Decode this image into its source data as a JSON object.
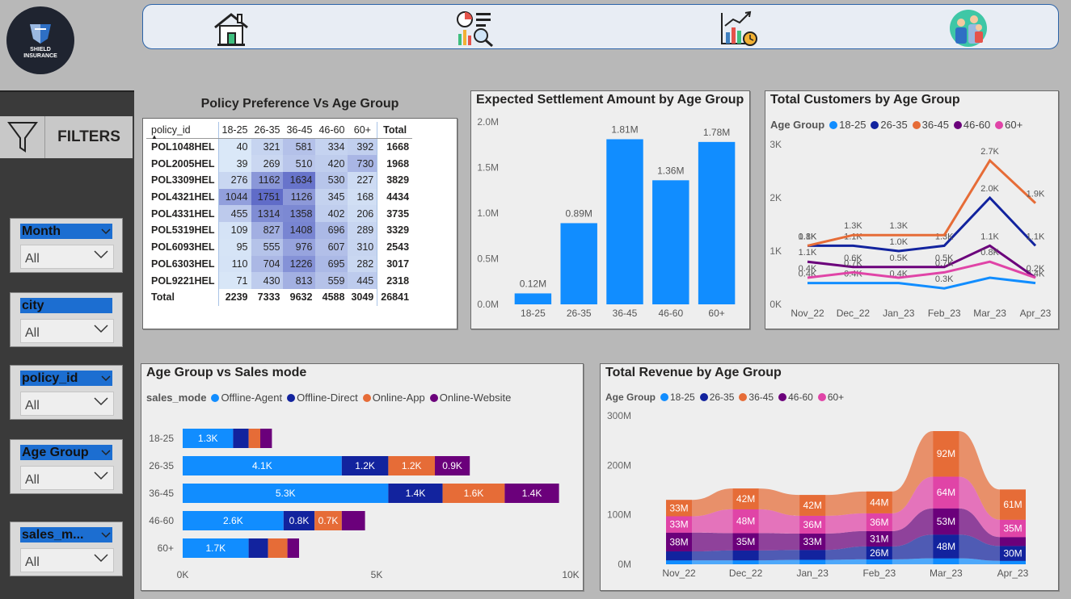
{
  "logo": {
    "line1": "SHIELD",
    "line2": "INSURANCE"
  },
  "nav": {
    "icons": [
      "home-icon",
      "analysis-report-icon",
      "growth-chart-icon",
      "customers-group-icon"
    ]
  },
  "filters": {
    "header": "FILTERS",
    "slicers": [
      {
        "title": "Month",
        "value": "All"
      },
      {
        "title": "city",
        "value": "All"
      },
      {
        "title": "policy_id",
        "value": "All"
      },
      {
        "title": "Age Group",
        "value": "All"
      },
      {
        "title": "sales_m...",
        "value": "All"
      }
    ]
  },
  "matrix": {
    "title": "Policy Preference Vs Age Group",
    "columns": [
      "policy_id",
      "18-25",
      "26-35",
      "36-45",
      "46-60",
      "60+",
      "Total"
    ],
    "rows": [
      {
        "id": "POL1048HEL",
        "vals": [
          40,
          321,
          581,
          334,
          392
        ],
        "total": 1668
      },
      {
        "id": "POL2005HEL",
        "vals": [
          39,
          269,
          510,
          420,
          730
        ],
        "total": 1968
      },
      {
        "id": "POL3309HEL",
        "vals": [
          276,
          1162,
          1634,
          530,
          227
        ],
        "total": 3829
      },
      {
        "id": "POL4321HEL",
        "vals": [
          1044,
          1751,
          1126,
          345,
          168
        ],
        "total": 4434
      },
      {
        "id": "POL4331HEL",
        "vals": [
          455,
          1314,
          1358,
          402,
          206
        ],
        "total": 3735
      },
      {
        "id": "POL5319HEL",
        "vals": [
          109,
          827,
          1408,
          696,
          289
        ],
        "total": 3329
      },
      {
        "id": "POL6093HEL",
        "vals": [
          95,
          555,
          976,
          607,
          310
        ],
        "total": 2543
      },
      {
        "id": "POL6303HEL",
        "vals": [
          110,
          704,
          1226,
          695,
          282
        ],
        "total": 3017
      },
      {
        "id": "POL9221HEL",
        "vals": [
          71,
          430,
          813,
          559,
          445
        ],
        "total": 2318
      }
    ],
    "total_row": {
      "label": "Total",
      "vals": [
        2239,
        7333,
        9632,
        4588,
        3049
      ],
      "total": 26841
    }
  },
  "chart_data": [
    {
      "id": "settlement",
      "type": "bar",
      "title": "Expected Settlement Amount by Age Group",
      "categories": [
        "18-25",
        "26-35",
        "36-45",
        "46-60",
        "60+"
      ],
      "values": [
        0.12,
        0.89,
        1.81,
        1.36,
        1.78
      ],
      "labels": [
        "0.12M",
        "0.89M",
        "1.81M",
        "1.36M",
        "1.78M"
      ],
      "yticks": [
        "0.0M",
        "0.5M",
        "1.0M",
        "1.5M",
        "2.0M"
      ],
      "ylim": [
        0,
        2.0
      ],
      "color": "#118dff"
    },
    {
      "id": "customers",
      "type": "line",
      "title": "Total Customers by Age Group",
      "legend_title": "Age Group",
      "x": [
        "Nov_22",
        "Dec_22",
        "Jan_23",
        "Feb_23",
        "Mar_23",
        "Apr_23"
      ],
      "yticks": [
        "0K",
        "1K",
        "2K",
        "3K"
      ],
      "ylim": [
        0,
        3
      ],
      "series": [
        {
          "name": "18-25",
          "color": "#118dff",
          "values": [
            0.4,
            0.4,
            0.4,
            0.3,
            0.5,
            0.4
          ],
          "labels": [
            "0.4K",
            "0.4K",
            "0.4K",
            "0.3K",
            "",
            "0.4K"
          ]
        },
        {
          "name": "26-35",
          "color": "#12239e",
          "values": [
            1.1,
            1.1,
            1.0,
            1.1,
            2.0,
            1.1
          ],
          "labels": [
            "1.1K",
            "1.1K",
            "1.0K",
            "1.3K",
            "2.0K",
            "1.1K"
          ]
        },
        {
          "name": "36-45",
          "color": "#e66c37",
          "values": [
            1.1,
            1.3,
            1.3,
            1.3,
            2.7,
            1.9
          ],
          "labels": [
            "0.8K",
            "1.3K",
            "1.3K",
            "",
            "2.7K",
            "1.9K"
          ]
        },
        {
          "name": "46-60",
          "color": "#6b007b",
          "values": [
            0.8,
            0.7,
            0.7,
            0.7,
            1.1,
            0.5
          ],
          "labels": [
            "1.1K",
            "0.6K",
            "0.5K",
            "0.5K",
            "1.1K",
            "0.2K"
          ]
        },
        {
          "name": "60+",
          "color": "#e044a7",
          "values": [
            0.5,
            0.6,
            0.5,
            0.6,
            0.8,
            0.5
          ],
          "labels": [
            "0.4K",
            "0.7K",
            "",
            "0.7K",
            "0.8K",
            ""
          ]
        }
      ]
    },
    {
      "id": "salesmode",
      "type": "bar",
      "title": "Age Group vs Sales mode",
      "legend_title": "sales_mode",
      "categories": [
        "18-25",
        "26-35",
        "36-45",
        "46-60",
        "60+"
      ],
      "xticks": [
        "0K",
        "5K",
        "10K"
      ],
      "xlim": [
        0,
        10
      ],
      "series": [
        {
          "name": "Offline-Agent",
          "color": "#118dff",
          "values": [
            1.3,
            4.1,
            5.3,
            2.6,
            1.7
          ],
          "labels": [
            "1.3K",
            "4.1K",
            "5.3K",
            "2.6K",
            "1.7K"
          ]
        },
        {
          "name": "Offline-Direct",
          "color": "#12239e",
          "values": [
            0.4,
            1.2,
            1.4,
            0.8,
            0.5
          ],
          "labels": [
            "",
            "1.2K",
            "1.4K",
            "0.8K",
            ""
          ]
        },
        {
          "name": "Online-App",
          "color": "#e66c37",
          "values": [
            0.3,
            1.2,
            1.6,
            0.7,
            0.5
          ],
          "labels": [
            "",
            "1.2K",
            "1.6K",
            "0.7K",
            ""
          ]
        },
        {
          "name": "Online-Website",
          "color": "#6b007b",
          "values": [
            0.3,
            0.9,
            1.4,
            0.6,
            0.3
          ],
          "labels": [
            "",
            "0.9K",
            "1.4K",
            "",
            ""
          ]
        }
      ]
    },
    {
      "id": "revenue",
      "type": "area",
      "title": "Total Revenue by Age Group",
      "legend_title": "Age Group",
      "x": [
        "Nov_22",
        "Dec_22",
        "Jan_23",
        "Feb_23",
        "Mar_23",
        "Apr_23"
      ],
      "yticks": [
        "0M",
        "100M",
        "200M",
        "300M"
      ],
      "ylim": [
        0,
        300
      ],
      "series": [
        {
          "name": "18-25",
          "color": "#118dff",
          "values": [
            8,
            8,
            9,
            10,
            12,
            7
          ],
          "labels": [
            "",
            "",
            "",
            "",
            "",
            ""
          ]
        },
        {
          "name": "26-35",
          "color": "#12239e",
          "values": [
            18,
            20,
            20,
            26,
            48,
            30
          ],
          "labels": [
            "",
            "",
            "",
            "26M",
            "48M",
            "30M"
          ]
        },
        {
          "name": "46-60",
          "color": "#6b007b",
          "values": [
            38,
            35,
            33,
            31,
            53,
            18
          ],
          "labels": [
            "38M",
            "35M",
            "33M",
            "31M",
            "53M",
            ""
          ]
        },
        {
          "name": "60+",
          "color": "#e044a7",
          "values": [
            33,
            48,
            36,
            36,
            64,
            35
          ],
          "labels": [
            "33M",
            "48M",
            "36M",
            "36M",
            "64M",
            "35M"
          ]
        },
        {
          "name": "36-45",
          "color": "#e66c37",
          "values": [
            33,
            42,
            42,
            44,
            92,
            61
          ],
          "labels": [
            "33M",
            "42M",
            "42M",
            "44M",
            "92M",
            "61M"
          ]
        }
      ]
    }
  ]
}
